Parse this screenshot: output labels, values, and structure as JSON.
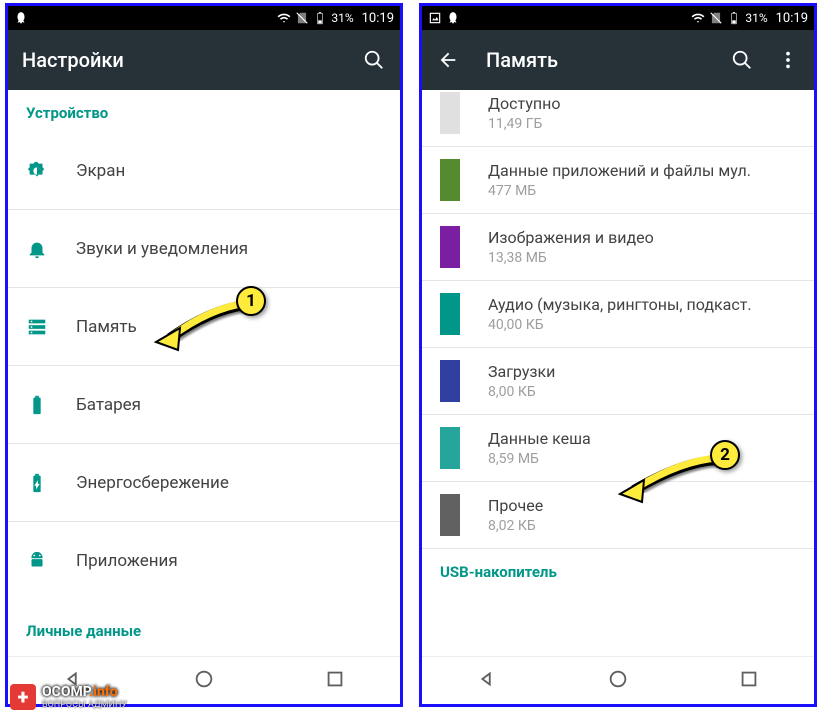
{
  "status": {
    "battery_pct": "31%",
    "clock": "10:19"
  },
  "left": {
    "title": "Настройки",
    "section": "Устройство",
    "items": [
      {
        "label": "Экран"
      },
      {
        "label": "Звуки и уведомления"
      },
      {
        "label": "Память"
      },
      {
        "label": "Батарея"
      },
      {
        "label": "Энергосбережение"
      },
      {
        "label": "Приложения"
      }
    ],
    "footer_section": "Личные данные"
  },
  "right": {
    "title": "Память",
    "items": [
      {
        "title": "Доступно",
        "sub": "11,49 ГБ",
        "color": "#e0e0e0"
      },
      {
        "title": "Данные приложений и файлы мул.",
        "sub": "477 МБ",
        "color": "#558b2f"
      },
      {
        "title": "Изображения и видео",
        "sub": "13,38 МБ",
        "color": "#7b1fa2"
      },
      {
        "title": "Аудио (музыка, рингтоны, подкаст.",
        "sub": "40,00 КБ",
        "color": "#009688"
      },
      {
        "title": "Загрузки",
        "sub": "8,00 КБ",
        "color": "#303f9f"
      },
      {
        "title": "Данные кеша",
        "sub": "8,59 МБ",
        "color": "#26a69a"
      },
      {
        "title": "Прочее",
        "sub": "8,02 КБ",
        "color": "#616161"
      }
    ],
    "footer_section": "USB-накопитель"
  },
  "annotations": {
    "badge1": "1",
    "badge2": "2"
  },
  "watermark": {
    "brand": "OCOMP",
    "tld": ".info",
    "sub": "ВОПРОСЫ АДМИНУ"
  }
}
